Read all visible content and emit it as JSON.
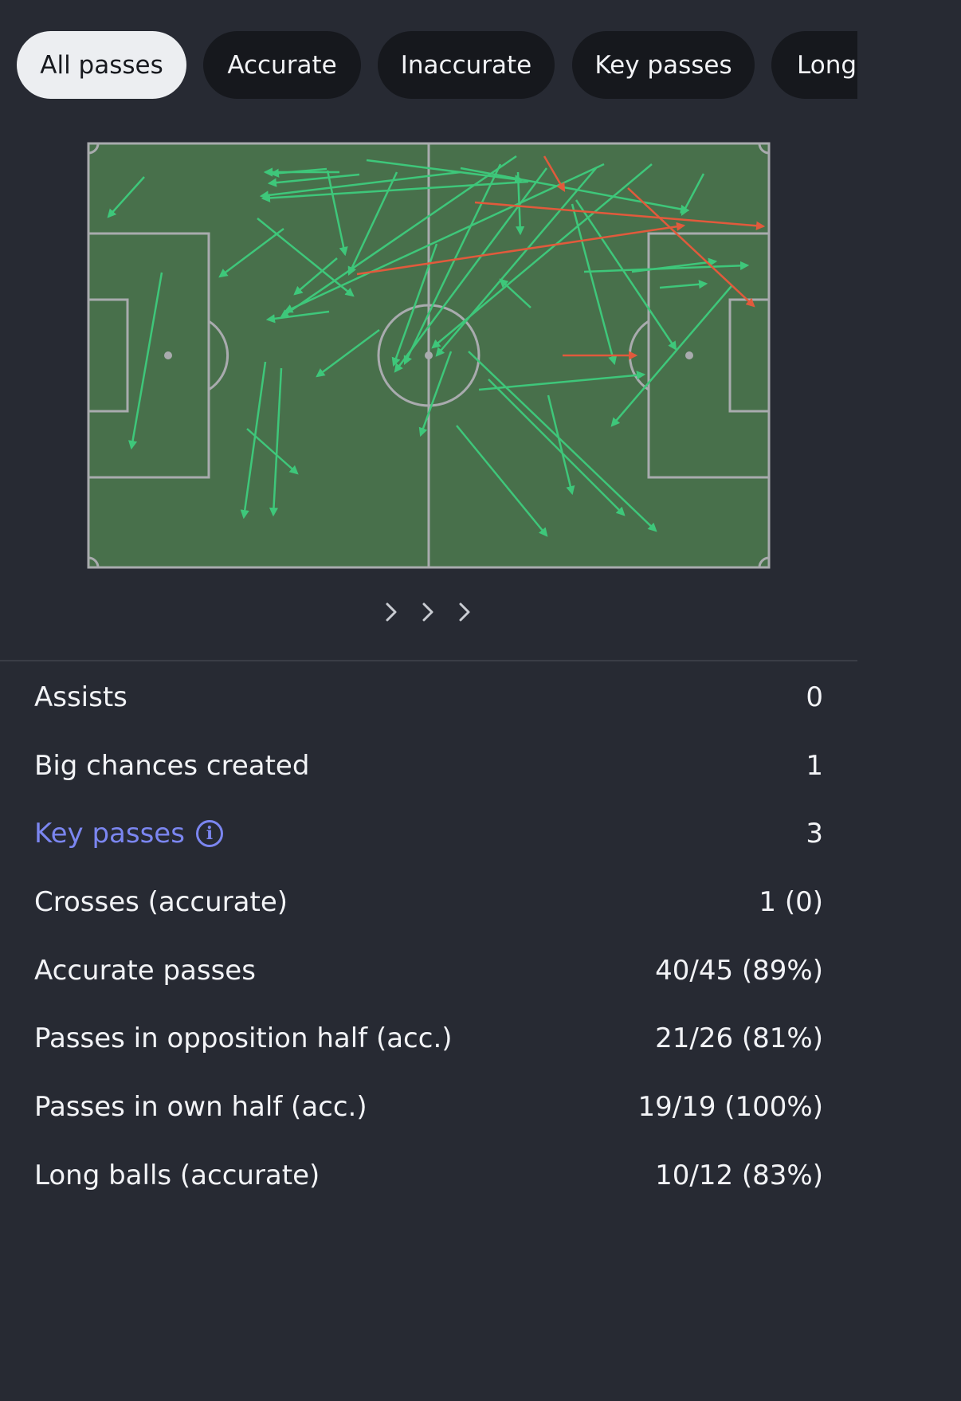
{
  "tabs": [
    {
      "label": "All passes",
      "active": true
    },
    {
      "label": "Accurate",
      "active": false
    },
    {
      "label": "Inaccurate",
      "active": false
    },
    {
      "label": "Key passes",
      "active": false
    },
    {
      "label": "Long",
      "active": false
    }
  ],
  "pitch": {
    "colors": {
      "grass": "#48704b",
      "lines": "#a9abae",
      "accurate": "#3ec77a",
      "inaccurate": "#e15a3c"
    }
  },
  "pager_icon": "chevron-right-icon",
  "stats": [
    {
      "label": "Assists",
      "value": "0"
    },
    {
      "label": "Big chances created",
      "value": "1"
    },
    {
      "label": "Key passes",
      "value": "3",
      "info_icon": "info-icon",
      "link": true
    },
    {
      "label": "Crosses (accurate)",
      "value": "1 (0)"
    },
    {
      "label": "Accurate passes",
      "value": "40/45 (89%)"
    },
    {
      "label": "Passes in opposition half (acc.)",
      "value": "21/26 (81%)"
    },
    {
      "label": "Passes in own half (acc.)",
      "value": "19/19 (100%)"
    },
    {
      "label": "Long balls (accurate)",
      "value": "10/12 (83%)"
    }
  ]
}
